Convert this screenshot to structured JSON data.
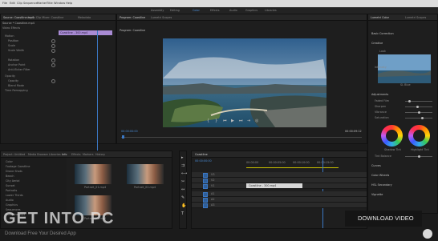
{
  "menu": [
    "File",
    "Edit",
    "Clip",
    "Sequence",
    "Marker",
    "Title",
    "Window",
    "Help"
  ],
  "workspaces": [
    "Assembly",
    "Editing",
    "Color",
    "Effects",
    "Audio",
    "Graphics",
    "Libraries"
  ],
  "workspace_active": "Color",
  "effect_controls": {
    "tabs": [
      "Source: Coastline.mp4",
      "Audio Clip Mixer: Coastline",
      "Metadata"
    ],
    "header": "Source * Coastline.mp4",
    "sections": [
      "Video Effects",
      "Motion",
      "Position",
      "Scale",
      "Scale Width",
      "Rotation",
      "Anchor Point",
      "Anti-flicker Filter",
      "Opacity",
      "Opacity",
      "Blend Mode",
      "Time Remapping"
    ],
    "clip_label": "Coastline - 300.mp4"
  },
  "program_monitor": {
    "tabs": [
      "Program: Coastline",
      "Lumetri Scopes"
    ],
    "title": "Program: Coastline",
    "timecode_left": "00:00:00:00",
    "timecode_right": "00:00:09:12"
  },
  "lumetri": {
    "tabs": [
      "Lumetri Color",
      "Lumetri Scopes"
    ],
    "sections": [
      "Basic Correction",
      "Creative",
      "Look",
      "Curves",
      "Color Wheels & Match",
      "HSL Secondary",
      "Vignette"
    ],
    "look_label": "Look",
    "preview_label": "SL Blue",
    "sliders": [
      "Intensity",
      "Adjustments",
      "Faded Film",
      "Sharpen",
      "Vibrance",
      "Saturation"
    ],
    "wheel_labels": [
      "Shadow Tint",
      "Highlight Tint"
    ],
    "tint_balance": "Tint Balance",
    "lower_sections": [
      "Curves",
      "Color Wheels",
      "HSL Secondary",
      "Vignette"
    ]
  },
  "project": {
    "tabs": [
      "Project: Untitled",
      "Media Browser",
      "Libraries",
      "Info",
      "Effects",
      "Markers",
      "History"
    ],
    "bins": [
      "Color",
      "Footage Coastline",
      "Drone Shots",
      "Beach",
      "City Aerial",
      "Sunset",
      "Portraits",
      "Lower Thirds",
      "Audio",
      "Graphics",
      "Sequences",
      "Coastline.mp4"
    ],
    "clips": [
      {
        "name": "Portrait_01.mp4",
        "duration": "0:12"
      },
      {
        "name": "Portrait_02.mp4",
        "duration": "0:08"
      },
      {
        "name": "Portrait_03.mp4",
        "duration": "0:10"
      }
    ]
  },
  "timeline": {
    "tab": "Coastline",
    "timecode": "00:00:00:00",
    "ruler": [
      "00:00:00",
      "00:00:05:00",
      "00:00:10:00",
      "00:00:15:00"
    ],
    "tracks": [
      "V3",
      "V2",
      "V1",
      "A1",
      "A2",
      "A3"
    ],
    "clip": "Coastline - 300.mp4"
  },
  "overlay": {
    "download": "DOWNLOAD VIDEO",
    "watermark_main": "GET INTO PC",
    "watermark_sub": "Download Free Your Desired App"
  },
  "colors": {
    "accent": "#4a8cd6",
    "clip_purple": "#a98bd4",
    "timeline_yellow": "#c9c000"
  }
}
